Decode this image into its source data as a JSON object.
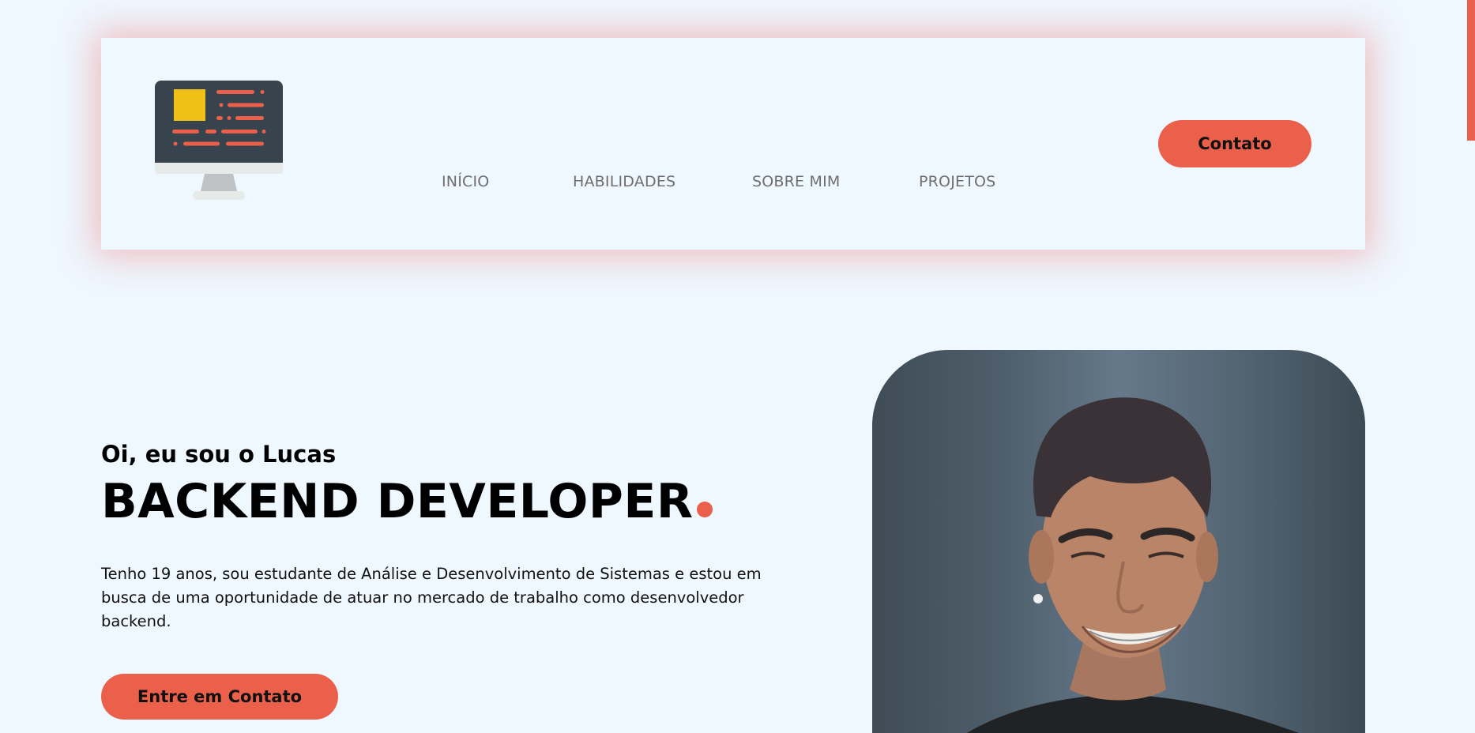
{
  "nav": {
    "links": [
      "INÍCIO",
      "HABILIDADES",
      "SOBRE MIM",
      "PROJETOS"
    ],
    "contact_label": "Contato"
  },
  "hero": {
    "greeting": "Oi, eu sou o Lucas",
    "title": "BACKEND DEVELOPER",
    "description": "Tenho 19 anos, sou estudante de Análise e Desenvolvimento de Sistemas e estou em busca de uma oportunidade de atuar no mercado de trabalho como desenvolvedor backend.",
    "cta_label": "Entre em Contato"
  },
  "icons": {
    "logo": "monitor-code-icon"
  },
  "colors": {
    "accent": "#ea604a",
    "background": "#eff7ff",
    "nav_text": "#706f6f",
    "logo_screen": "#37434d",
    "logo_square": "#f0c019"
  }
}
